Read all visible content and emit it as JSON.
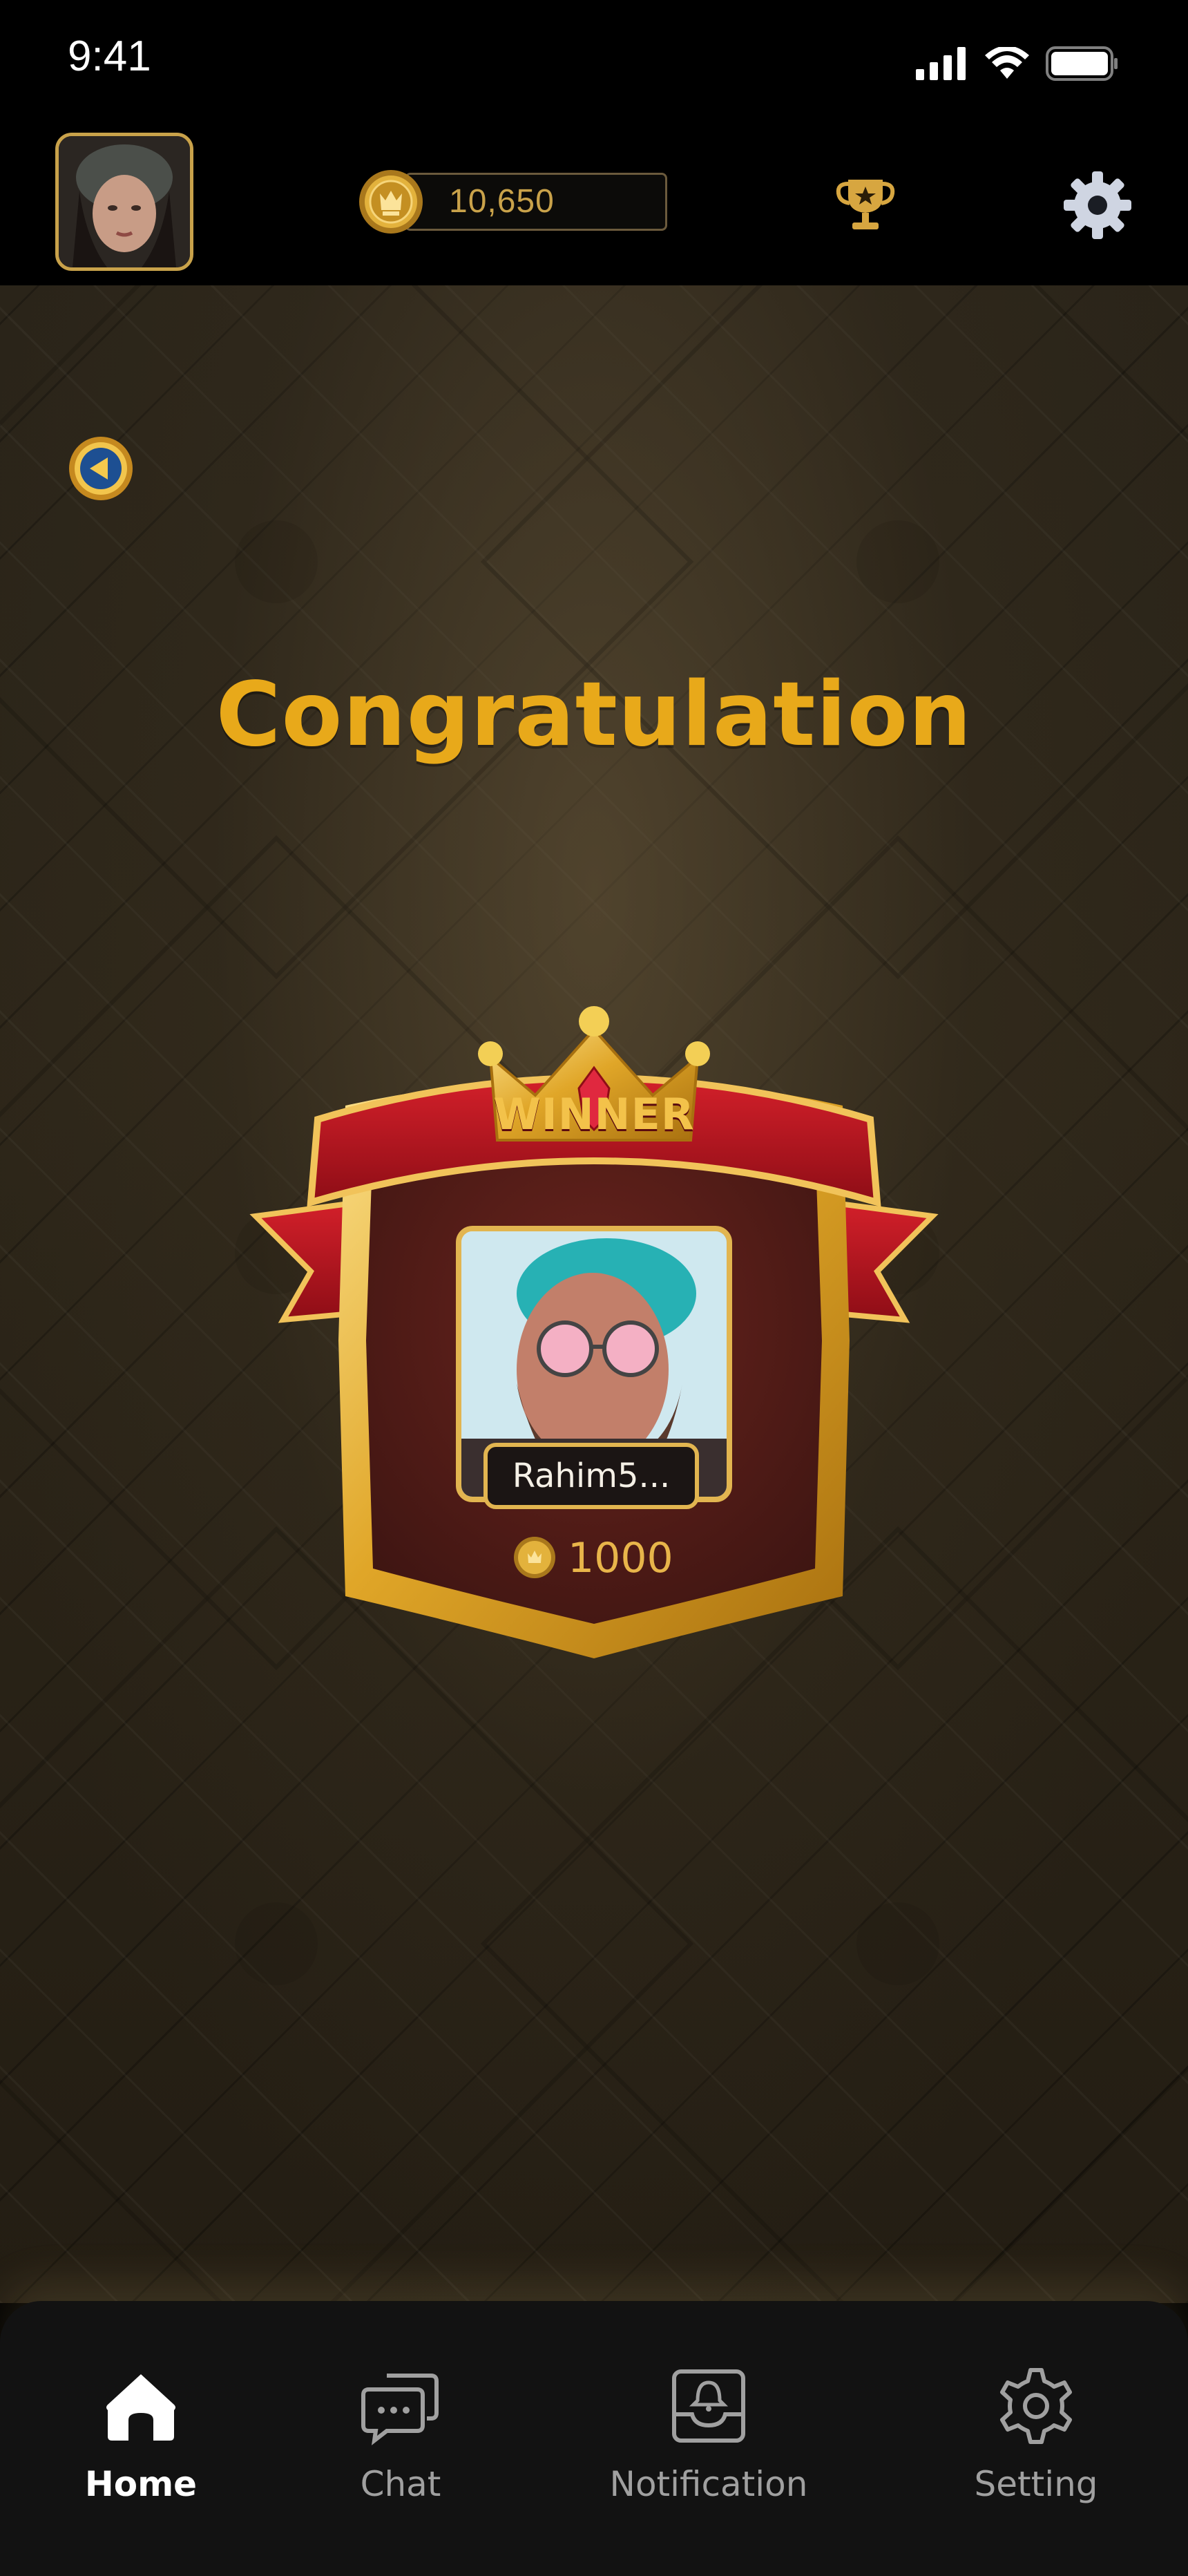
{
  "status_bar": {
    "time": "9:41"
  },
  "header": {
    "coin_balance": "10,650",
    "avatar_icon": "user-avatar",
    "trophy_icon": "trophy-icon",
    "settings_icon": "gear-icon"
  },
  "screen": {
    "title": "Congratulation",
    "badge_label": "WINNER",
    "winner": {
      "name": "Rahim5...",
      "coins": "1000"
    }
  },
  "bottom_nav": {
    "items": [
      {
        "label": "Home",
        "icon": "home-icon",
        "active": true
      },
      {
        "label": "Chat",
        "icon": "chat-icon",
        "active": false
      },
      {
        "label": "Notification",
        "icon": "notification-icon",
        "active": false
      },
      {
        "label": "Setting",
        "icon": "settings-icon",
        "active": false
      }
    ]
  },
  "colors": {
    "gold": "#e8a91a",
    "gold_light": "#f3cc5c",
    "ribbon_red": "#b3121e",
    "card_maroon": "#4a1a16",
    "bg_dark": "#2a2419",
    "nav_bg": "#121212"
  }
}
